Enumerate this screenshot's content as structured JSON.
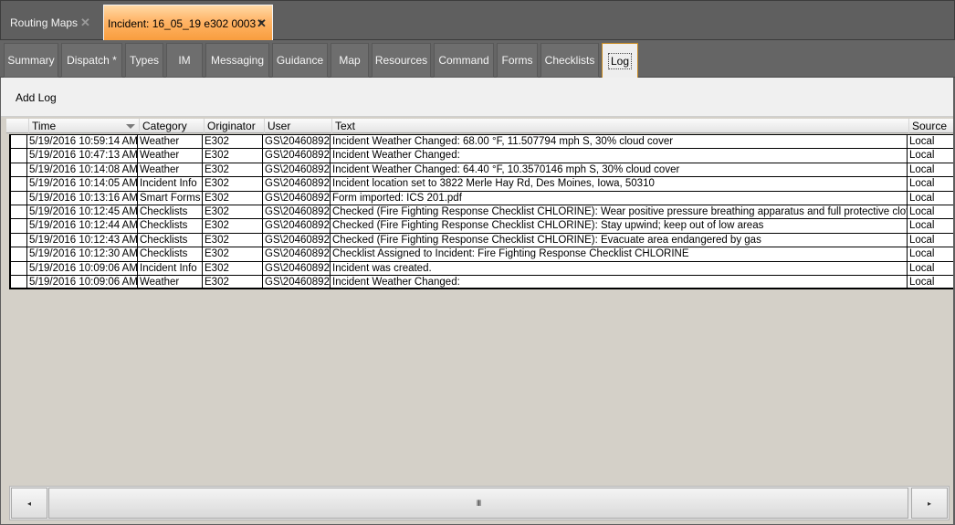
{
  "doc_tabs": [
    {
      "label": "Routing Maps",
      "close": "✕"
    },
    {
      "label": "Incident: 16_05_19 e302 0003 *",
      "close": "✕"
    }
  ],
  "sub_tabs": [
    {
      "label": "Summary"
    },
    {
      "label": "Dispatch *"
    },
    {
      "label": "Types"
    },
    {
      "label": "IM"
    },
    {
      "label": "Messaging"
    },
    {
      "label": "Guidance"
    },
    {
      "label": "Map"
    },
    {
      "label": "Resources"
    },
    {
      "label": "Command"
    },
    {
      "label": "Forms"
    },
    {
      "label": "Checklists"
    },
    {
      "label": "Log"
    }
  ],
  "toolbar": {
    "add_log": "Add Log"
  },
  "grid": {
    "columns": [
      "Time",
      "Category",
      "Originator",
      "User",
      "Text",
      "Source"
    ],
    "rows": [
      [
        "5/19/2016 10:59:14 AM",
        "Weather",
        "E302",
        "GS\\20460892",
        "Incident Weather Changed: 68.00 °F, 11.507794 mph S, 30% cloud cover",
        "Local"
      ],
      [
        "5/19/2016 10:47:13 AM",
        "Weather",
        "E302",
        "GS\\20460892",
        "Incident Weather Changed:",
        "Local"
      ],
      [
        "5/19/2016 10:14:08 AM",
        "Weather",
        "E302",
        "GS\\20460892",
        "Incident Weather Changed: 64.40 °F, 10.3570146 mph S, 30% cloud cover",
        "Local"
      ],
      [
        "5/19/2016 10:14:05 AM",
        "Incident Info",
        "E302",
        "GS\\20460892",
        "Incident location set to 3822 Merle Hay Rd, Des Moines, Iowa, 50310",
        "Local"
      ],
      [
        "5/19/2016 10:13:16 AM",
        "Smart Forms",
        "E302",
        "GS\\20460892",
        "Form imported: ICS 201.pdf",
        "Local"
      ],
      [
        "5/19/2016 10:12:45 AM",
        "Checklists",
        "E302",
        "GS\\20460892",
        "Checked (Fire Fighting Response Checklist CHLORINE): Wear positive pressure breathing apparatus and full protective clothing",
        "Local"
      ],
      [
        "5/19/2016 10:12:44 AM",
        "Checklists",
        "E302",
        "GS\\20460892",
        "Checked (Fire Fighting Response Checklist CHLORINE): Stay upwind; keep out of low areas",
        "Local"
      ],
      [
        "5/19/2016 10:12:43 AM",
        "Checklists",
        "E302",
        "GS\\20460892",
        "Checked (Fire Fighting Response Checklist CHLORINE): Evacuate area endangered by gas",
        "Local"
      ],
      [
        "5/19/2016 10:12:30 AM",
        "Checklists",
        "E302",
        "GS\\20460892",
        "Checklist Assigned to Incident: Fire Fighting Response Checklist CHLORINE",
        "Local"
      ],
      [
        "5/19/2016 10:09:06 AM",
        "Incident Info",
        "E302",
        "GS\\20460892",
        "Incident was created.",
        "Local"
      ],
      [
        "5/19/2016 10:09:06 AM",
        "Weather",
        "E302",
        "GS\\20460892",
        "Incident Weather Changed:",
        "Local"
      ]
    ]
  },
  "scrollbar": {
    "left_glyph": "◂",
    "right_glyph": "▸",
    "thumb_glyph": "III"
  }
}
